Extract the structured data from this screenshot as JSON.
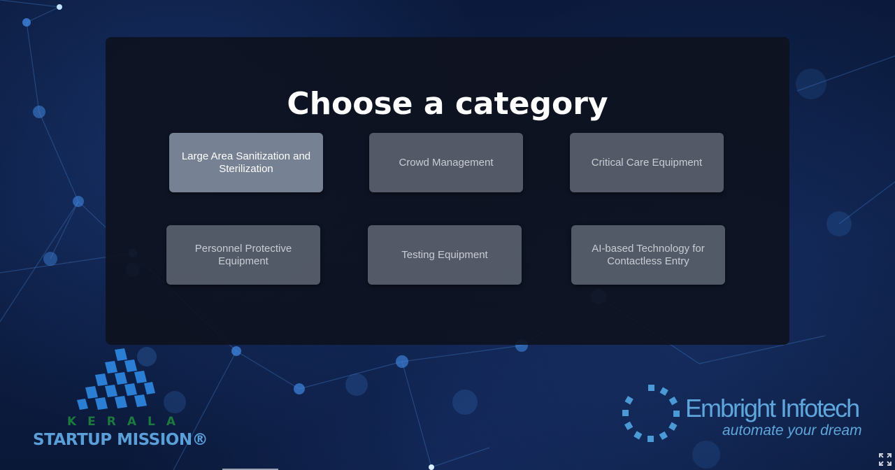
{
  "panel": {
    "title": "Choose a category"
  },
  "categories": [
    {
      "label": "Large Area Sanitization and Sterilization",
      "active": true
    },
    {
      "label": "Crowd Management",
      "active": false
    },
    {
      "label": "Critical Care Equipment",
      "active": false
    },
    {
      "label": "Personnel Protective Equipment",
      "active": false
    },
    {
      "label": "Testing Equipment",
      "active": false
    },
    {
      "label": "AI-based Technology for Contactless Entry",
      "active": false
    }
  ],
  "logos": {
    "ksum": {
      "line1": "KERALA",
      "line2": "STARTUP MISSION®"
    },
    "embright": {
      "name": "Embright Infotech",
      "tagline": "automate your dream"
    }
  },
  "icons": {
    "fullscreen": "fullscreen-icon"
  },
  "colors": {
    "background": "#0d1e44",
    "panel": "#0e121e",
    "button": "#5f6673",
    "button_active": "#7d879b",
    "ksum_green": "#1c7a3e",
    "ksum_blue": "#5a9fd8",
    "embright_blue": "#5ea6dc"
  }
}
